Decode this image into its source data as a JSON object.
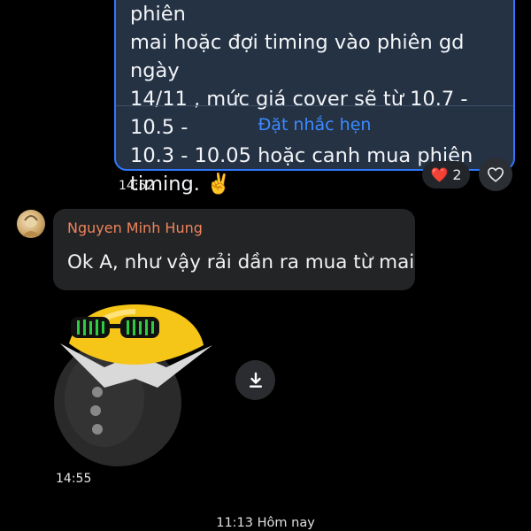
{
  "outgoing_message": {
    "lines": [
      "kiến, mn có thể canh mua lại từ phiên",
      "mai hoặc đợi timing vào phiên gd ngày",
      "14/11 , mức giá cover sẽ từ 10.7 - 10.5 -",
      "10.3 - 10.05 hoặc canh mua phiên",
      "timing. ✌️"
    ],
    "reminder_link": "Đặt nhắc hẹn",
    "reaction": {
      "emoji": "❤️",
      "count": "2"
    },
    "react_icon": "heart-outline-icon",
    "time": "14:52"
  },
  "incoming_message": {
    "sender": "Nguyen Minh Hung",
    "text": "Ok A, như vậy rải dần ra mua từ mai",
    "sticker_icon": "cool-emoji-sticker",
    "download_icon": "download-icon",
    "time": "14:55"
  },
  "separator": {
    "text": "11:13 Hôm nay"
  },
  "colors": {
    "background": "#000000",
    "outgoing_bubble": "#243244",
    "outgoing_border": "#2f78ff",
    "incoming_bubble": "#232426",
    "sender_name": "#f0835a",
    "link": "#3c8bff"
  }
}
